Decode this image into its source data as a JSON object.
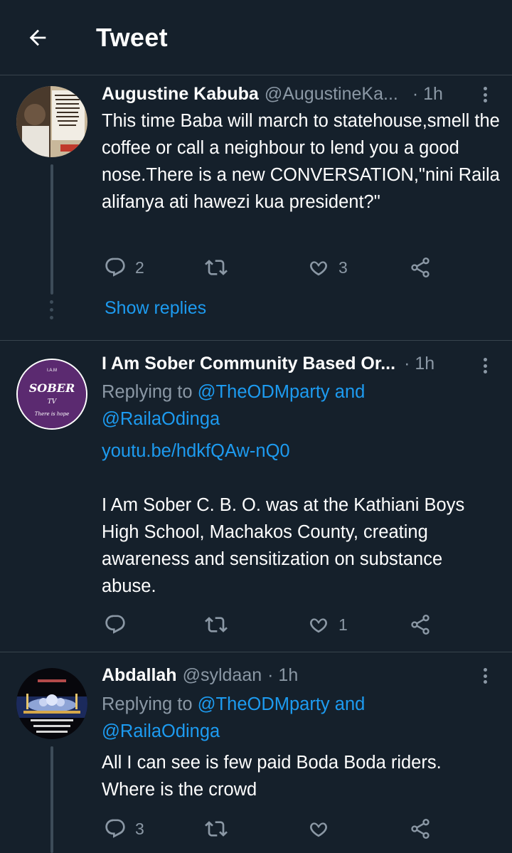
{
  "header": {
    "title": "Tweet"
  },
  "tweets": [
    {
      "name": "Augustine Kabuba",
      "handle": "@AugustineKa...",
      "time": "· 1h",
      "text": "This time Baba will march to statehouse,smell the coffee or call a neighbour to lend you a good nose.There is a new CONVERSATION,\"nini Raila alifanya ati hawezi kua president?\"",
      "replies": "2",
      "retweets": "",
      "likes": "3",
      "show_replies": "Show replies",
      "avatar_text": "Poverty is not an accident. Like slavery and apartheid, it is man-made and can be removed by the actions of human beings."
    },
    {
      "name": "I Am Sober Community Based Or...",
      "handle": "",
      "time": "· 1h",
      "reply_prefix": "Replying to ",
      "reply_user1": "@TheODMparty",
      "reply_and": " and",
      "reply_user2": "@RailaOdinga",
      "link": "youtu.be/hdkfQAw-nQ0",
      "text": "I Am Sober C. B. O. was at the Kathiani Boys High School, Machakos County, creating awareness and sensitization on substance abuse.",
      "replies": "",
      "retweets": "",
      "likes": "1",
      "avatar_top": "I.A.M",
      "avatar_main": "SOBER",
      "avatar_tv": "TV",
      "avatar_bottom": "There is hope"
    },
    {
      "name": "Abdallah",
      "handle": "@syldaan",
      "time": "· 1h",
      "reply_prefix": "Replying to ",
      "reply_user1": "@TheODMparty",
      "reply_and": " and",
      "reply_user2": "@RailaOdinga",
      "text": "All I can see is few paid Boda Boda riders.\nWhere is the crowd",
      "replies": "3",
      "retweets": "",
      "likes": ""
    }
  ],
  "colors": {
    "background": "#15202b",
    "link": "#1d9bf0",
    "muted": "#8b98a5",
    "divider": "#38444d"
  }
}
